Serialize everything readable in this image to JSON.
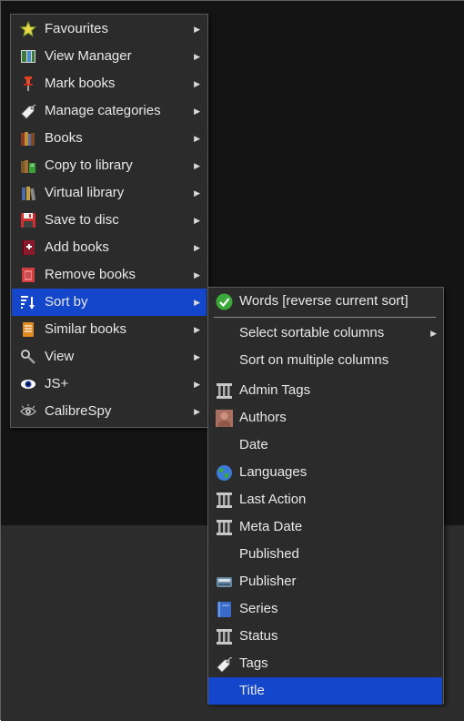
{
  "main_menu": {
    "items": [
      {
        "label": "Favourites",
        "icon": "star-icon"
      },
      {
        "label": "View Manager",
        "icon": "view-manager-icon"
      },
      {
        "label": "Mark books",
        "icon": "pin-icon"
      },
      {
        "label": "Manage categories",
        "icon": "tag-icon"
      },
      {
        "label": "Books",
        "icon": "books-icon"
      },
      {
        "label": "Copy to library",
        "icon": "copy-library-icon"
      },
      {
        "label": "Virtual library",
        "icon": "virtual-library-icon"
      },
      {
        "label": "Save to disc",
        "icon": "save-icon"
      },
      {
        "label": "Add books",
        "icon": "add-book-icon"
      },
      {
        "label": "Remove books",
        "icon": "trash-icon"
      },
      {
        "label": "Sort by",
        "icon": "sort-icon"
      },
      {
        "label": "Similar books",
        "icon": "similar-books-icon"
      },
      {
        "label": "View",
        "icon": "magnifier-icon"
      },
      {
        "label": "JS+",
        "icon": "eye-icon"
      },
      {
        "label": "CalibreSpy",
        "icon": "spy-eye-icon"
      }
    ],
    "highlighted": "Sort by"
  },
  "sort_submenu": {
    "reverse": "Words [reverse current sort]",
    "select_columns": "Select sortable columns",
    "multi_columns": "Sort on multiple columns",
    "columns": [
      {
        "label": "Admin Tags",
        "icon": "column-icon"
      },
      {
        "label": "Authors",
        "icon": "author-icon"
      },
      {
        "label": "Date",
        "icon": ""
      },
      {
        "label": "Languages",
        "icon": "globe-icon"
      },
      {
        "label": "Last Action",
        "icon": "column-icon"
      },
      {
        "label": "Meta Date",
        "icon": "column-icon"
      },
      {
        "label": "Published",
        "icon": ""
      },
      {
        "label": "Publisher",
        "icon": "publisher-icon"
      },
      {
        "label": "Series",
        "icon": "series-icon"
      },
      {
        "label": "Status",
        "icon": "column-icon"
      },
      {
        "label": "Tags",
        "icon": "tag-icon"
      },
      {
        "label": "Title",
        "icon": ""
      }
    ],
    "highlighted": "Title"
  },
  "colors": {
    "highlight": "#1446cc",
    "menu_bg": "#2b2b2b",
    "text": "#e8e8e8"
  }
}
